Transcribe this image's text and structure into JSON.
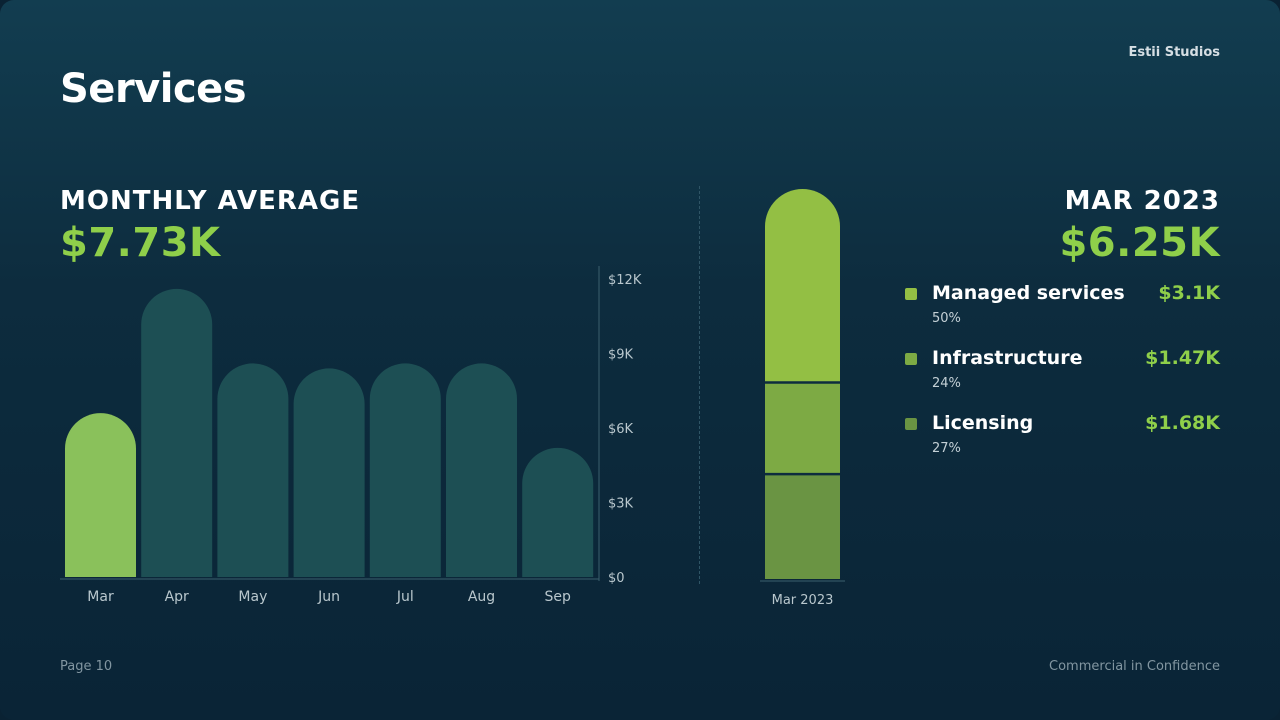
{
  "header": {
    "brand": "Estii Studios",
    "title": "Services"
  },
  "monthly": {
    "label": "MONTHLY AVERAGE",
    "value": "$7.73K"
  },
  "current": {
    "label": "MAR 2023",
    "value": "$6.25K"
  },
  "chart_data": [
    {
      "type": "bar",
      "categories": [
        "Mar",
        "Apr",
        "May",
        "Jun",
        "Jul",
        "Aug",
        "Sep"
      ],
      "values": [
        6.6,
        11.6,
        8.6,
        8.4,
        8.6,
        8.6,
        5.2
      ],
      "highlight_index": 0,
      "y_ticks": [
        "$0",
        "$3K",
        "$6K",
        "$9K",
        "$12K"
      ],
      "ylim": [
        0,
        12
      ],
      "colors": {
        "highlight": "#8ac15b",
        "default": "#1d4f54",
        "axis": "#3b5f6d",
        "tick_text": "#b9c7cd"
      }
    },
    {
      "type": "bar",
      "stacked": true,
      "categories": [
        "Mar 2023"
      ],
      "series": [
        {
          "name": "Licensing",
          "values": [
            1.68
          ],
          "color": "#6a9443"
        },
        {
          "name": "Infrastructure",
          "values": [
            1.47
          ],
          "color": "#7daa44"
        },
        {
          "name": "Managed services",
          "values": [
            3.1
          ],
          "color": "#93bf44"
        }
      ],
      "ylim": [
        0,
        6.25
      ]
    }
  ],
  "legend": [
    {
      "label": "Managed services",
      "value": "$3.1K",
      "pct": "50%",
      "color": "#93bf44"
    },
    {
      "label": "Infrastructure",
      "value": "$1.47K",
      "pct": "24%",
      "color": "#7daa44"
    },
    {
      "label": "Licensing",
      "value": "$1.68K",
      "pct": "27%",
      "color": "#6a9443"
    }
  ],
  "footer": {
    "page": "Page 10",
    "confidential": "Commercial in Confidence"
  }
}
